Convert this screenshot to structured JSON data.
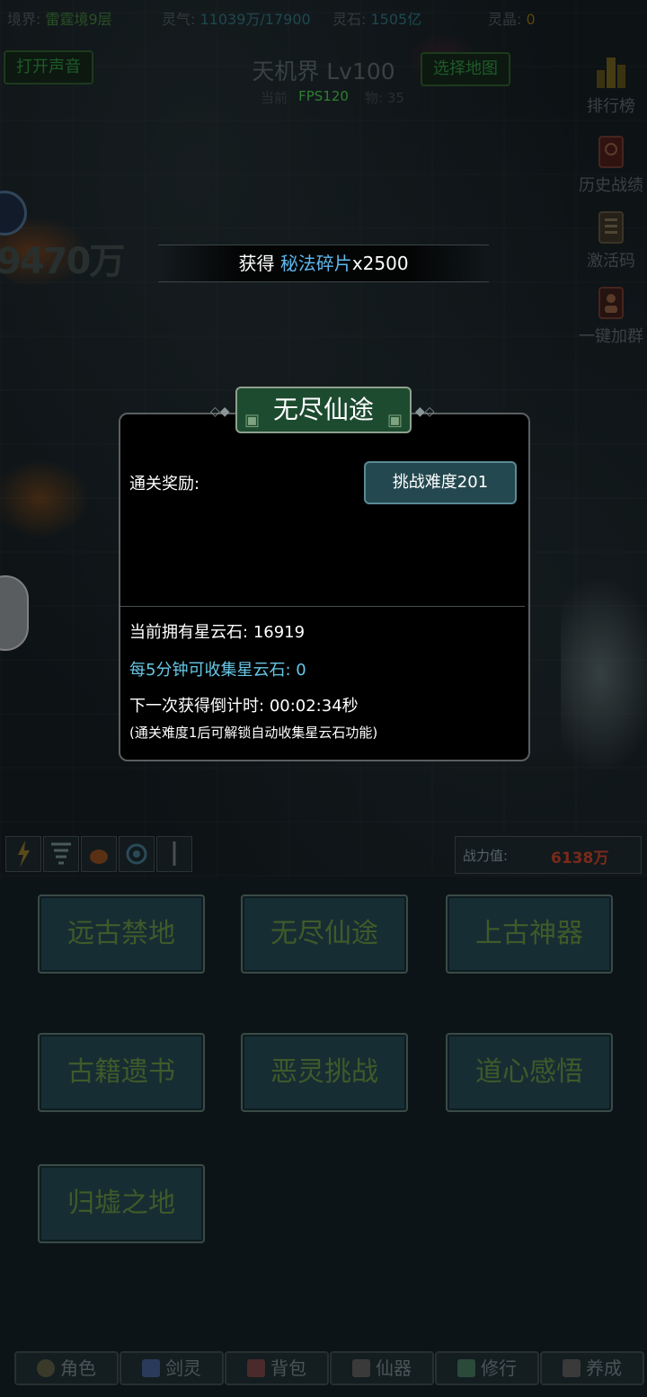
{
  "status": {
    "realm_label": "境界:",
    "realm_value": "雷霆境9层",
    "qi_label": "灵气:",
    "qi_value": "11039万/17900",
    "stone_label": "灵石:",
    "stone_value": "1505亿",
    "crystal_label": "灵晶:",
    "crystal_value": "0"
  },
  "header": {
    "sound_button": "打开声音",
    "realm_title": "天机界 Lv100",
    "monster_prefix": "当前",
    "monster_suffix": "物:",
    "monster_count": "35",
    "fps": "FPS120",
    "map_button": "选择地图"
  },
  "side_menu": [
    {
      "label": "排行榜",
      "icon": "ranking-icon"
    },
    {
      "label": "历史战绩",
      "icon": "history-icon"
    },
    {
      "label": "激活码",
      "icon": "code-icon"
    },
    {
      "label": "一键加群",
      "icon": "group-icon"
    }
  ],
  "battle": {
    "damage_text": "9470万"
  },
  "toast": {
    "prefix": "获得 ",
    "item": "秘法碎片",
    "suffix": "x2500"
  },
  "dialog": {
    "title": "无尽仙途",
    "reward_label": "通关奖励:",
    "challenge_button": "挑战难度201",
    "owned_label": "当前拥有星云石:",
    "owned_value": "16919",
    "rate_label": "每5分钟可收集星云石:",
    "rate_value": "0",
    "countdown_label": "下一次获得倒计时:",
    "countdown_value": "00:02:34秒",
    "note": "(通关难度1后可解锁自动收集星云石功能)"
  },
  "power": {
    "label": "战力值:",
    "value": "6138万"
  },
  "menu": [
    {
      "label": "远古禁地"
    },
    {
      "label": "无尽仙途"
    },
    {
      "label": "上古神器"
    },
    {
      "label": "古籍遗书"
    },
    {
      "label": "恶灵挑战"
    },
    {
      "label": "道心感悟"
    },
    {
      "label": "归墟之地"
    }
  ],
  "nav": [
    {
      "label": "角色",
      "icon": "character-icon"
    },
    {
      "label": "剑灵",
      "icon": "sword-spirit-icon"
    },
    {
      "label": "背包",
      "icon": "bag-icon"
    },
    {
      "label": "仙器",
      "icon": "artifact-icon"
    },
    {
      "label": "修行",
      "icon": "cultivation-icon"
    },
    {
      "label": "养成",
      "icon": "nurture-icon"
    }
  ],
  "colors": {
    "accent_blue": "#5fb7ef",
    "cyan_text": "#67c7e6",
    "fps_green": "#48c24a",
    "power_red": "#7a2a1a",
    "title_green": "#1d4b2f"
  }
}
